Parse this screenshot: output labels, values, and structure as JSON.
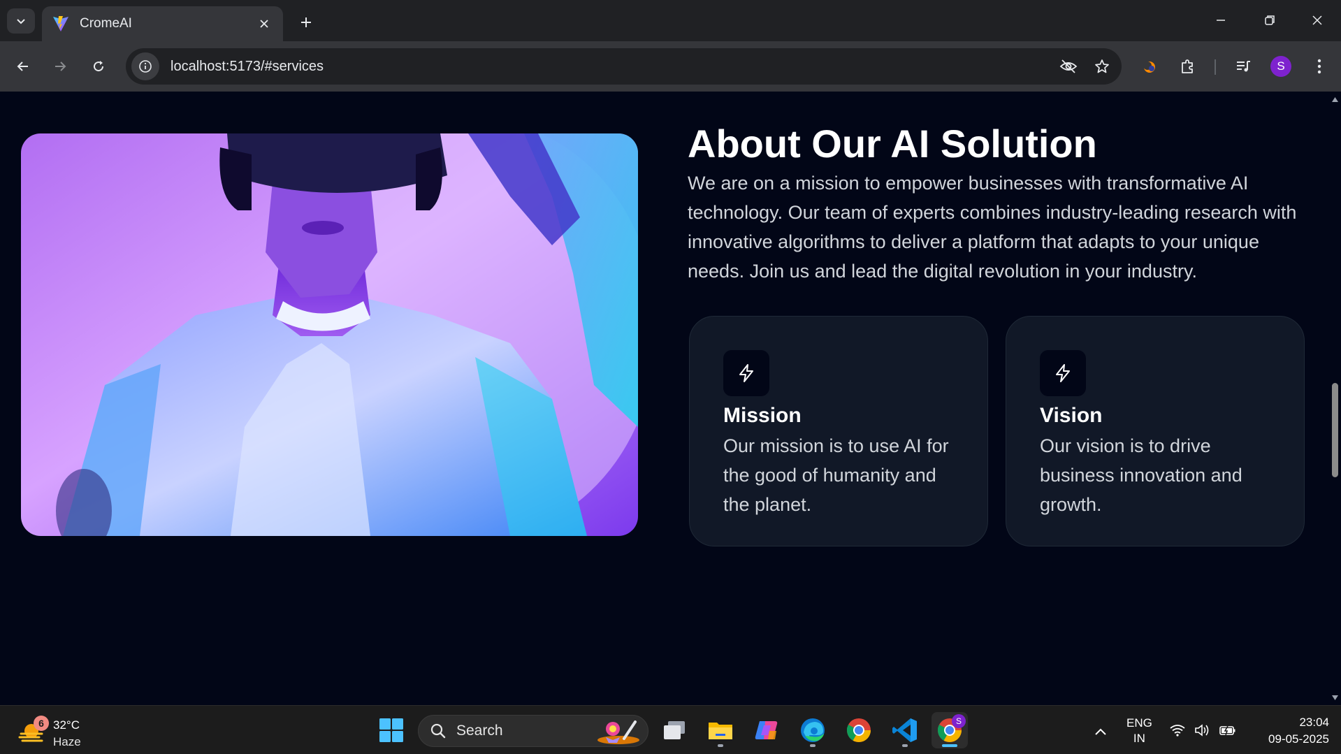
{
  "browser": {
    "tab_title": "CromeAI",
    "url": "localhost:5173/#services",
    "profile_initial": "S"
  },
  "page": {
    "about_title": "About Our AI Solution",
    "about_text": "We are on a mission to empower businesses with transformative AI technology. Our team of experts combines industry-leading research with innovative algorithms to deliver a platform that adapts to your unique needs. Join us and lead the digital revolution in your industry.",
    "cards": [
      {
        "title": "Mission",
        "text": "Our mission is to use AI for the good of humanity and the planet.",
        "icon": "bolt-icon"
      },
      {
        "title": "Vision",
        "text": "Our vision is to drive business innovation and growth.",
        "icon": "bolt-icon"
      }
    ],
    "colors": {
      "background": "#020617",
      "card": "#111827",
      "accent": "#a855f7"
    }
  },
  "taskbar": {
    "weather_badge": "6",
    "weather_temp": "32°C",
    "weather_condition": "Haze",
    "search_label": "Search",
    "lang_line1": "ENG",
    "lang_line2": "IN",
    "time": "23:04",
    "date": "09-05-2025",
    "chrome_badge": "S"
  }
}
